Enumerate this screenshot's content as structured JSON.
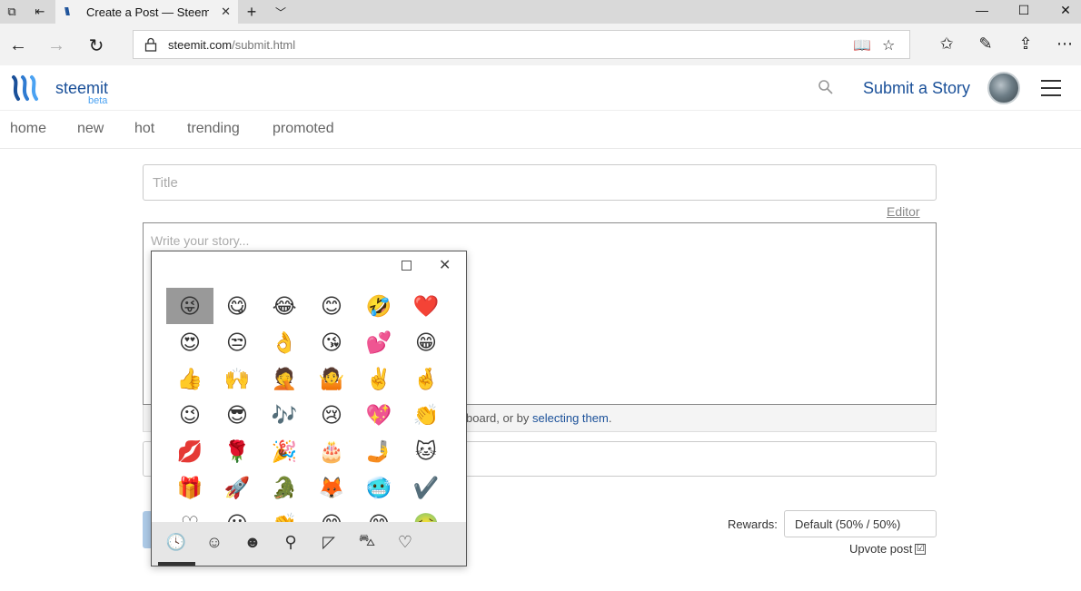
{
  "browser": {
    "tab_title": "Create a Post — Steemi",
    "url_host": "steemit.com",
    "url_path": "/submit.html"
  },
  "header": {
    "brand": "steemit",
    "beta": "beta",
    "submit_story": "Submit a Story"
  },
  "subnav": [
    "home",
    "new",
    "hot",
    "trending",
    "promoted"
  ],
  "form": {
    "title_placeholder": "Title",
    "editor_link": "Editor",
    "story_placeholder": "Write your story...",
    "drop_text_prefix": "board, or by ",
    "drop_text_link": "selecting them",
    "drop_text_suffix": ".",
    "rewards_label": "Rewards:",
    "rewards_value": "Default (50% / 50%)",
    "upvote_label": "Upvote post",
    "upvote_checked": "☑"
  },
  "emoji_panel": {
    "rows": [
      [
        "😜",
        "😋",
        "😂",
        "😊",
        "🤣",
        "❤️"
      ],
      [
        "😍",
        "😒",
        "👌",
        "😘",
        "💕",
        "😁"
      ],
      [
        "👍",
        "🙌",
        "🤦",
        "🤷",
        "✌️",
        "🤞"
      ],
      [
        "😉",
        "😎",
        "🎶",
        "😢",
        "💖",
        "👏"
      ],
      [
        "💋",
        "🌹",
        "🎉",
        "🎂",
        "🤳",
        "🐱"
      ],
      [
        "🎁",
        "🚀",
        "🐊",
        "🦊",
        "🥶",
        "✔️"
      ],
      [
        "♡",
        "😀",
        "👏",
        "😊",
        "😊",
        "🤢"
      ]
    ],
    "tabs": [
      "recent-icon",
      "smiley-icon",
      "person-icon",
      "balloon-icon",
      "pizza-icon",
      "car-icon",
      "heart-icon"
    ],
    "tab_glyphs": [
      "🕓",
      "☺",
      "☻",
      "⚲",
      "◸",
      "⛍",
      "♡"
    ]
  }
}
